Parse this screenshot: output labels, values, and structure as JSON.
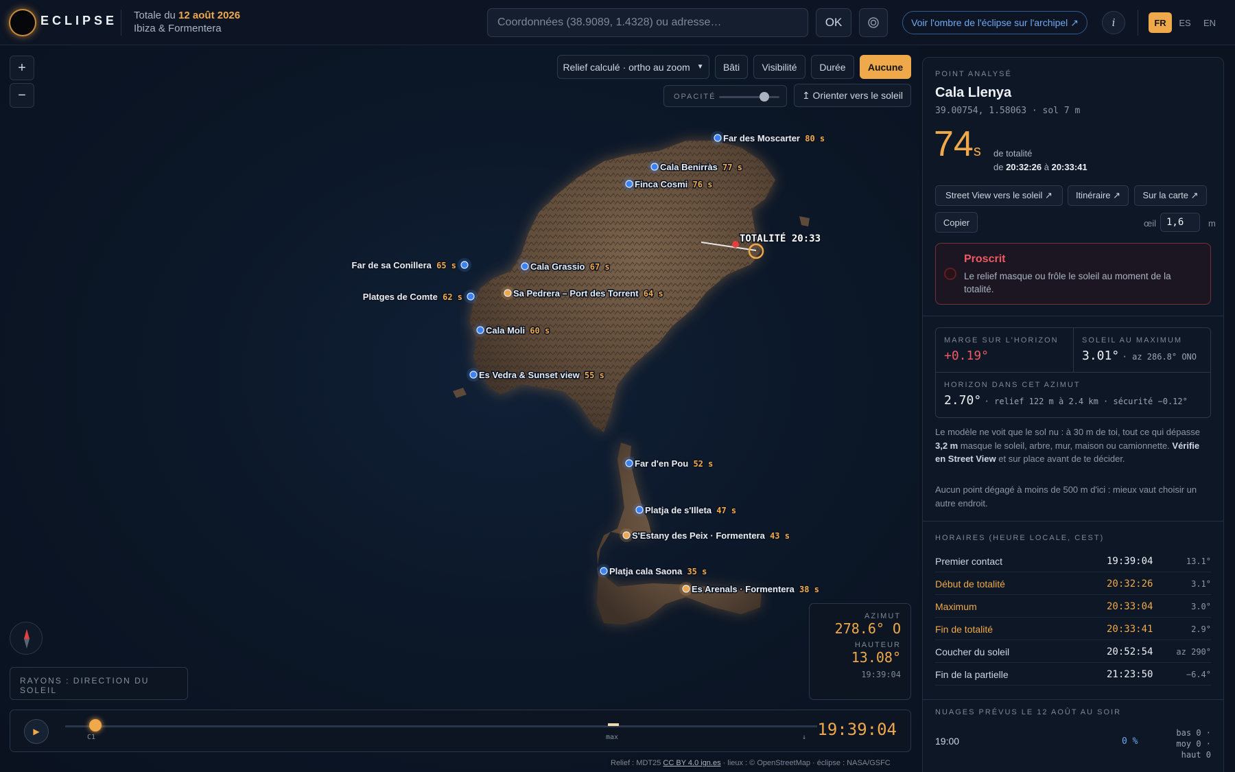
{
  "header": {
    "brand": "ECLIPSE",
    "subtitle_prefix": "Totale du ",
    "subtitle_date": "12 août 2026",
    "subtitle_place": "Ibiza & Formentera",
    "search_placeholder": "Coordonnées (38.9089, 1.4328) ou adresse…",
    "ok_label": "OK",
    "locate_icon": "target-icon",
    "shadow_link": "Voir l'ombre de l'éclipse sur l'archipel ↗",
    "info_label": "i",
    "languages": [
      "FR",
      "ES",
      "EN"
    ],
    "active_language": "FR"
  },
  "map": {
    "zoom_in": "+",
    "zoom_out": "−",
    "relief_select": "Relief calculé · ortho au zoom",
    "layer_buttons": [
      "Bâti",
      "Visibilité",
      "Durée",
      "Aucune"
    ],
    "active_layer": "Aucune",
    "opacity_label": "OPACITÉ",
    "opacity_value": 0.75,
    "orient_label": "↥ Orienter vers le soleil",
    "totality_label": "TOTALITÉ 20:33",
    "places": [
      {
        "name": "Far des Moscarter",
        "secs": "80 s",
        "kind": "blue"
      },
      {
        "name": "Cala Benirràs",
        "secs": "77 s",
        "kind": "blue"
      },
      {
        "name": "Finca Cosmi",
        "secs": "76 s",
        "kind": "blue"
      },
      {
        "name": "Far de sa Conillera",
        "secs": "65 s",
        "kind": "blue"
      },
      {
        "name": "Cala Grassio",
        "secs": "67 s",
        "kind": "blue"
      },
      {
        "name": "Platges de Comte",
        "secs": "62 s",
        "kind": "blue"
      },
      {
        "name": "Sa Pedrera – Port des Torrent",
        "secs": "64 s",
        "kind": "orange"
      },
      {
        "name": "Cala Moli",
        "secs": "60 s",
        "kind": "blue"
      },
      {
        "name": "Es Vedra & Sunset view",
        "secs": "55 s",
        "kind": "blue"
      },
      {
        "name": "Far d'en Pou",
        "secs": "52 s",
        "kind": "blue"
      },
      {
        "name": "Platja de s'Illeta",
        "secs": "47 s",
        "kind": "blue"
      },
      {
        "name": "S'Estany des Peix · Formentera",
        "secs": "43 s",
        "kind": "orange"
      },
      {
        "name": "Platja cala Saona",
        "secs": "35 s",
        "kind": "blue"
      },
      {
        "name": "Es Arenals · Formentera",
        "secs": "38 s",
        "kind": "orange"
      }
    ],
    "compass_icon": "compass-icon",
    "rays_label": "RAYONS : DIRECTION DU SOLEIL",
    "azimut_label": "AZIMUT",
    "azimut_value": "278.6° O",
    "hauteur_label": "HAUTEUR",
    "hauteur_value": "13.08°",
    "sun_time": "19:39:04",
    "timeline": {
      "play_icon": "▶",
      "c1_label": "C1",
      "max_label": "max",
      "end_label": "↓",
      "time": "19:39:04",
      "progress": 0.04
    },
    "attribution_prefix": "Relief : MDT25 ",
    "attribution_license": "CC BY 4.0 ign.es",
    "attribution_suffix": " · lieux : © OpenStreetMap · éclipse : NASA/GSFC"
  },
  "panel": {
    "section_label": "POINT ANALYSÉ",
    "name": "Cala Llenya",
    "coords": "39.00754, 1.58063 · sol 7 m",
    "totality_seconds": "74",
    "totality_unit": "s",
    "totality_text": "de totalité",
    "totality_from_prefix": "de ",
    "totality_from": "20:32:26",
    "totality_mid": " à ",
    "totality_to": "20:33:41",
    "buttons": [
      "Street View vers le soleil ↗",
      "Itinéraire ↗",
      "Sur la carte ↗",
      "Copier"
    ],
    "eye_label": "œil",
    "eye_value": "1,6",
    "eye_unit": "m",
    "alert_title": "Proscrit",
    "alert_text": "Le relief masque ou frôle le soleil au moment de la totalité.",
    "margin_label": "MARGE SUR L'HORIZON",
    "margin_value": "+0.19°",
    "sunmax_label": "SOLEIL AU MAXIMUM",
    "sunmax_value": "3.01°",
    "sunmax_extra": "· az 286.8° ONO",
    "horizon_label": "HORIZON DANS CET AZIMUT",
    "horizon_value": "2.70°",
    "horizon_extra": "· relief 122 m à 2.4 km · sécurité −0.12°",
    "note1_a": "Le modèle ne voit que le sol nu : à 30 m de toi, tout ce qui dépasse ",
    "note1_b": "3,2 m",
    "note1_c": " masque le soleil, arbre, mur, maison ou camionnette. ",
    "note1_d": "Vérifie en Street View",
    "note1_e": " et sur place avant de te décider.",
    "note2": "Aucun point dégagé à moins de 500 m d'ici : mieux vaut choisir un autre endroit.",
    "times_label": "HORAIRES (HEURE LOCALE, CEST)",
    "times": [
      {
        "name": "Premier contact",
        "time": "19:39:04",
        "deg": "13.1°",
        "hl": false
      },
      {
        "name": "Début de totalité",
        "time": "20:32:26",
        "deg": "3.1°",
        "hl": true
      },
      {
        "name": "Maximum",
        "time": "20:33:04",
        "deg": "3.0°",
        "hl": true
      },
      {
        "name": "Fin de totalité",
        "time": "20:33:41",
        "deg": "2.9°",
        "hl": true
      },
      {
        "name": "Coucher du soleil",
        "time": "20:52:54",
        "deg": "az 290°",
        "hl": false
      },
      {
        "name": "Fin de la partielle",
        "time": "21:23:50",
        "deg": "−6.4°",
        "hl": false
      }
    ],
    "clouds_label": "NUAGES PRÉVUS LE 12 AOÛT AU SOIR",
    "cloud_time": "19:00",
    "cloud_pct": "0 %",
    "cloud_bas": "bas 0 ·",
    "cloud_moy": "moy 0 ·",
    "cloud_haut": "haut 0"
  },
  "colors": {
    "accent": "#f0a94a",
    "danger": "#ef5a63",
    "link": "#6eaaf0",
    "background": "#0b1220"
  }
}
